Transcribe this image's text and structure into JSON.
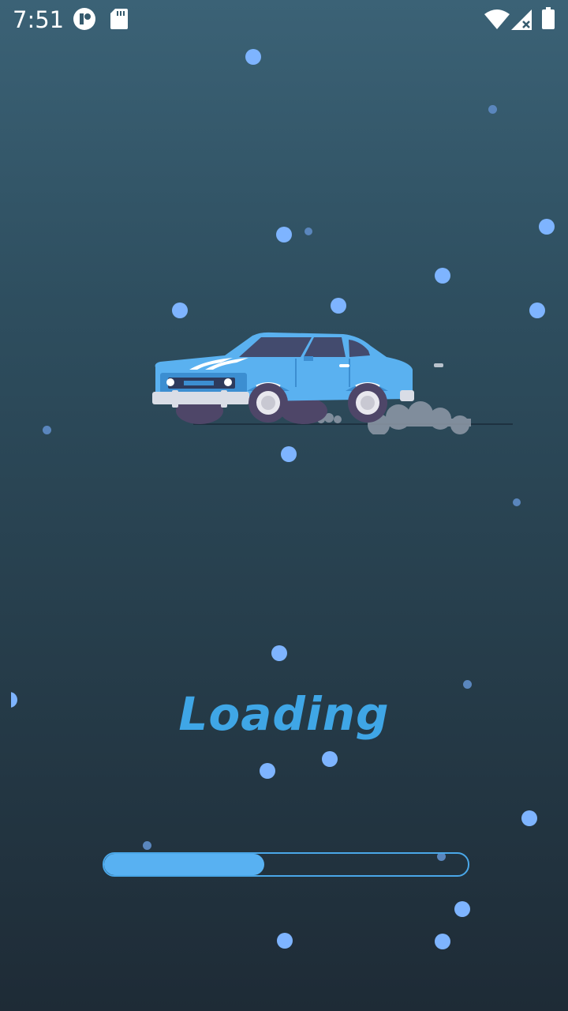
{
  "status_bar": {
    "time": "7:51",
    "left_icons": [
      "pocket-casts-icon",
      "sd-card-icon"
    ],
    "right_icons": [
      "wifi-icon",
      "signal-no-data-icon",
      "battery-icon"
    ]
  },
  "scene": {
    "illustration": "car-icon"
  },
  "loading": {
    "label": "Loading",
    "progress": 0.44
  },
  "colors": {
    "accent": "#3fa6e6",
    "progress_fill": "#58b1f2",
    "dots": "#7eb4ff",
    "background_top": "#3b6276",
    "background_bottom": "#1e2b36"
  }
}
